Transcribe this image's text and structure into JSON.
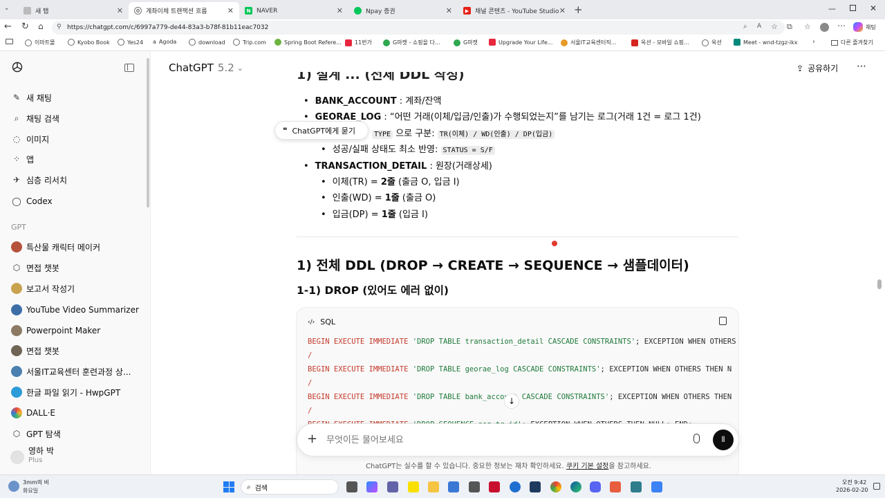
{
  "browser": {
    "tabs": [
      {
        "title": "새 탭"
      },
      {
        "title": "계좌이체 트랜잭션 흐름"
      },
      {
        "title": "NAVER"
      },
      {
        "title": "Npay 증권"
      },
      {
        "title": "채널 콘텐츠 - YouTube Studio"
      }
    ],
    "url": "https://chatgpt.com/c/6997a779-de44-83a3-b78f-81b11eac7032",
    "bookmarks": [
      "이마트몰",
      "Kyobo Book",
      "Yes24",
      "Agoda",
      "download",
      "Trip.com",
      "Spring Boot Refere...",
      "11번가",
      "G마켓 - 쇼핑을 다...",
      "G마켓",
      "Upgrade Your Life...",
      "서울IT교육센터직...",
      "옥션 - 모바일 쇼핑...",
      "옥션",
      "Meet - wnd-tzgz-ikx"
    ],
    "other_bookmarks": "다른 즐겨찾기"
  },
  "sidebar": {
    "main_items": [
      "새 채팅",
      "채팅 검색",
      "이미지",
      "앱",
      "심층 리서치",
      "Codex"
    ],
    "gpt_heading": "GPT",
    "gpts": [
      "특산물 캐릭터 메이커",
      "면접 챗봇",
      "보고서 작성기",
      "YouTube Video Summarizer",
      "Powerpoint Maker",
      "면접 챗봇",
      "서울IT교육센터 훈련과정 상...",
      "한글 파일 읽기 - HwpGPT",
      "DALL·E",
      "GPT 탐색"
    ],
    "user_name": "영하 박",
    "user_plan": "Plus"
  },
  "header": {
    "model": "ChatGPT",
    "version": "5.2",
    "share": "공유하기"
  },
  "content": {
    "top_partial": "1) 설계 ... (전체 DDL 작성)",
    "bullets": [
      {
        "title": "BANK_ACCOUNT",
        "desc": " : 계좌/잔액"
      },
      {
        "title": "GEORAE_LOG",
        "desc": " : “어떤 거래(이체/입금/인출)가 수행되었는지”를 남기는 로그(거래 1건 = 로그 1건)"
      }
    ],
    "sub1_code_prefix": "TYPE",
    "sub1_text": " 으로 구분: ",
    "sub1_code": "TR(이체) / WD(인출) / DP(입금)",
    "sub2_text": "성공/실패 상태도 최소 반영: ",
    "sub2_code": "STATUS = S/F",
    "td_title": "TRANSACTION_DETAIL",
    "td_desc": " : 원장(거래상세)",
    "td_items": [
      {
        "pre": "이체(TR) = ",
        "bold": "2줄",
        "post": " (출금 O, 입금 I)"
      },
      {
        "pre": "인출(WD) = ",
        "bold": "1줄",
        "post": " (출금 O)"
      },
      {
        "pre": "입금(DP) = ",
        "bold": "1줄",
        "post": " (입금 I)"
      }
    ],
    "tooltip": "ChatGPT에게 묻기",
    "h1": "1) 전체 DDL (DROP → CREATE → SEQUENCE → 샘플데이터)",
    "h2": "1-1) DROP (있어도 에러 없이)",
    "code_lang": "SQL",
    "code_lines": [
      {
        "kw1": "BEGIN EXECUTE IMMEDIATE ",
        "str": "'DROP TABLE transaction_detail CASCADE CONSTRAINTS'",
        "rest": "; EXCEPTION WHEN OTHERS"
      },
      {
        "kw1": "/",
        "str": "",
        "rest": ""
      },
      {
        "kw1": "BEGIN EXECUTE IMMEDIATE ",
        "str": "'DROP TABLE georae_log CASCADE CONSTRAINTS'",
        "rest": "; EXCEPTION WHEN OTHERS THEN N"
      },
      {
        "kw1": "/",
        "str": "",
        "rest": ""
      },
      {
        "kw1": "BEGIN EXECUTE IMMEDIATE ",
        "str": "'DROP TABLE bank_account CASCADE CONSTRAINTS'",
        "rest": "; EXCEPTION WHEN OTHERS THEN"
      },
      {
        "kw1": "/",
        "str": "",
        "rest": ""
      },
      {
        "kw1": "BEGIN EXECUTE IMMEDIATE ",
        "str": "'DROP SEQUENCE seq_tr_id'",
        "rest": "; EXCEPTION WHEN OTHERS THEN NULL; END;"
      }
    ]
  },
  "composer": {
    "placeholder": "무엇이든 물어보세요"
  },
  "disclaimer": {
    "text": "ChatGPT는 실수를 할 수 있습니다. 중요한 정보는 재차 확인하세요. ",
    "link": "쿠키 기본 설정",
    "tail": "을 참고하세요."
  },
  "taskbar": {
    "weather_temp": "3mm의 비",
    "weather_day": "화요일",
    "search": "검색",
    "time": "오전 9:42",
    "date": "2026-02-20"
  },
  "colors": {
    "accent_red": "#c53a2b",
    "string_green": "#1f7a3b",
    "sidebar_bg": "#f9f9f9"
  }
}
